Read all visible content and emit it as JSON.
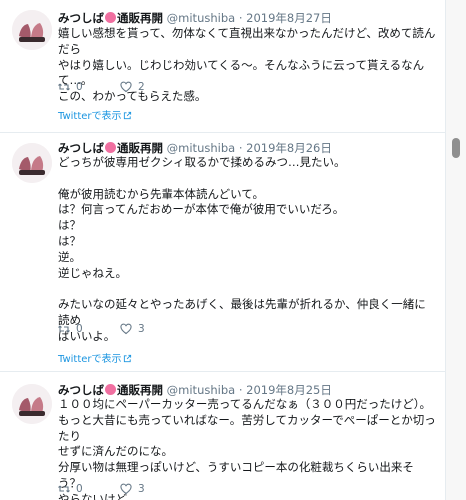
{
  "tweets": [
    {
      "name": "みつしば",
      "label": "通販再開",
      "handle": "@mitushiba",
      "separator": "·",
      "date": "2019年8月27日",
      "text": "嬉しい感想を貰って、勿体なくて直視出来なかったんだけど、改めて読んだら\nやはり嬉しい。じわじわ効いてくる〜。そんなふうに云って貰えるなんて…。\nこの、わかってもらえた感。",
      "retweets": "0",
      "likes": "2",
      "twitter_link": "Twitterで表示"
    },
    {
      "name": "みつしば",
      "label": "通販再開",
      "handle": "@mitushiba",
      "separator": "·",
      "date": "2019年8月26日",
      "text": "どっちが彼専用ゼクシィ取るかで揉めるみつ…見たい。\n\n俺が彼用読むから先輩本体読んどいて。\nは？何言ってんだおめーが本体で俺が彼用でいいだろ。\nは？\nは？\n逆。\n逆じゃねえ。\n\nみたいなの延々とやったあげく、最後は先輩が折れるか、仲良く一緒に読め\nばいいよ。",
      "retweets": "0",
      "likes": "3",
      "twitter_link": "Twitterで表示"
    },
    {
      "name": "みつしば",
      "label": "通販再開",
      "handle": "@mitushiba",
      "separator": "·",
      "date": "2019年8月25日",
      "text": "１００均にペーパーカッター売ってるんだなぁ（３００円だったけど）。\nもっと大昔にも売っていればなー。苦労してカッターでぺーぱーとか切ったり\nせずに済んだのにな。\n分厚い物は無理っぽいけど、うすいコピー本の化粧裁ちくらい出来そう？\nやらないけど…。",
      "retweets": "0",
      "likes": "3"
    }
  ],
  "icons": {
    "retweet": "retweet-icon",
    "like": "heart-icon",
    "external": "external-link-icon",
    "label_badge": "flower-icon"
  },
  "colors": {
    "link": "#1b95e0",
    "muted": "#657786",
    "badge": "#f06fa0"
  }
}
